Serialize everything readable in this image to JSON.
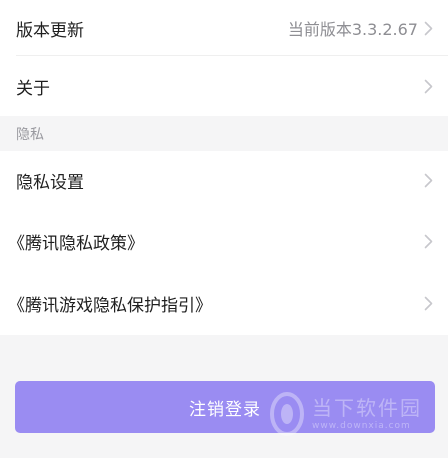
{
  "settings": {
    "version_row": {
      "label": "版本更新",
      "value": "当前版本3.3.2.67"
    },
    "about_row": {
      "label": "关于"
    }
  },
  "privacy": {
    "section_title": "隐私",
    "items": [
      {
        "label": "隐私设置"
      },
      {
        "label": "《腾讯隐私政策》"
      },
      {
        "label": "《腾讯游戏隐私保护指引》"
      }
    ]
  },
  "logout": {
    "label": "注销登录"
  },
  "watermark": {
    "text": "当下软件园",
    "url": "www.downxia.com"
  },
  "colors": {
    "accent": "#9a8cf2",
    "background": "#f5f5f6",
    "text_primary": "#1f1f1f",
    "text_secondary": "#8e8e93"
  }
}
